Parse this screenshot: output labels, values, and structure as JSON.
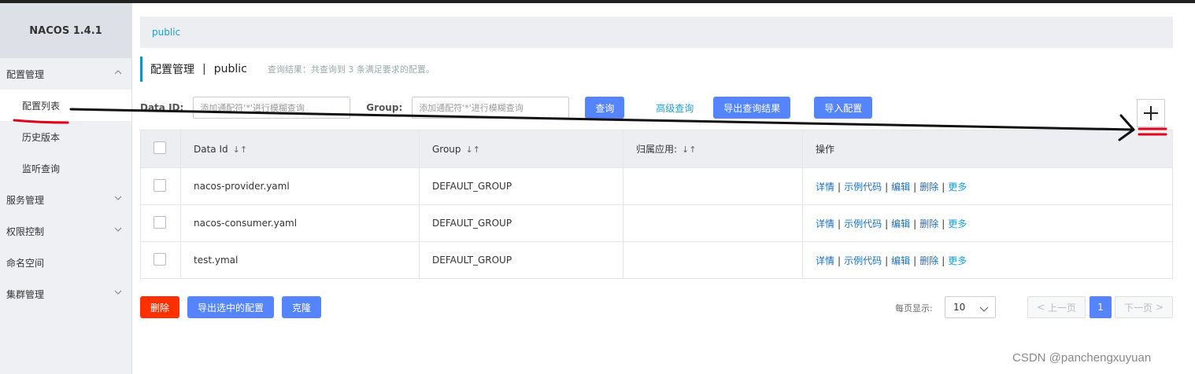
{
  "brand": "NACOS 1.4.1",
  "sidebar": {
    "items": [
      {
        "label": "配置管理"
      },
      {
        "label": "配置列表"
      },
      {
        "label": "历史版本"
      },
      {
        "label": "监听查询"
      },
      {
        "label": "服务管理"
      },
      {
        "label": "权限控制"
      },
      {
        "label": "命名空间"
      },
      {
        "label": "集群管理"
      }
    ]
  },
  "breadcrumb": "public",
  "header": {
    "title": "配置管理",
    "separator": "|",
    "namespace": "public",
    "hint": "查询结果：共查询到 3 条满足要求的配置。"
  },
  "filters": {
    "dataid_label": "Data ID:",
    "dataid_placeholder": "添加通配符'*'进行模糊查询",
    "group_label": "Group:",
    "group_placeholder": "添加通配符'*'进行模糊查询",
    "query": "查询",
    "advanced": "高级查询",
    "export_results": "导出查询结果",
    "import_config": "导入配置"
  },
  "add_button": "+",
  "table": {
    "columns": [
      "Data Id",
      "Group",
      "归属应用:",
      "操作"
    ],
    "rows": [
      {
        "data_id": "nacos-provider.yaml",
        "group": "DEFAULT_GROUP",
        "app": ""
      },
      {
        "data_id": "nacos-consumer.yaml",
        "group": "DEFAULT_GROUP",
        "app": ""
      },
      {
        "data_id": "test.ymal",
        "group": "DEFAULT_GROUP",
        "app": ""
      }
    ],
    "ops": [
      "详情",
      "示例代码",
      "编辑",
      "删除",
      "更多"
    ],
    "op_sep": "|"
  },
  "footer": {
    "delete": "删除",
    "export_selected": "导出选中的配置",
    "clone": "克隆",
    "page_size_label": "每页显示:",
    "page_size": "10",
    "prev": "上一页",
    "page": "1",
    "next": "下一页"
  },
  "watermark": "CSDN @panchengxuyuan",
  "colors": {
    "primary": "#5584ff",
    "danger": "#ff3000",
    "link": "#1aa0d8",
    "annotation": "#e0001b"
  }
}
